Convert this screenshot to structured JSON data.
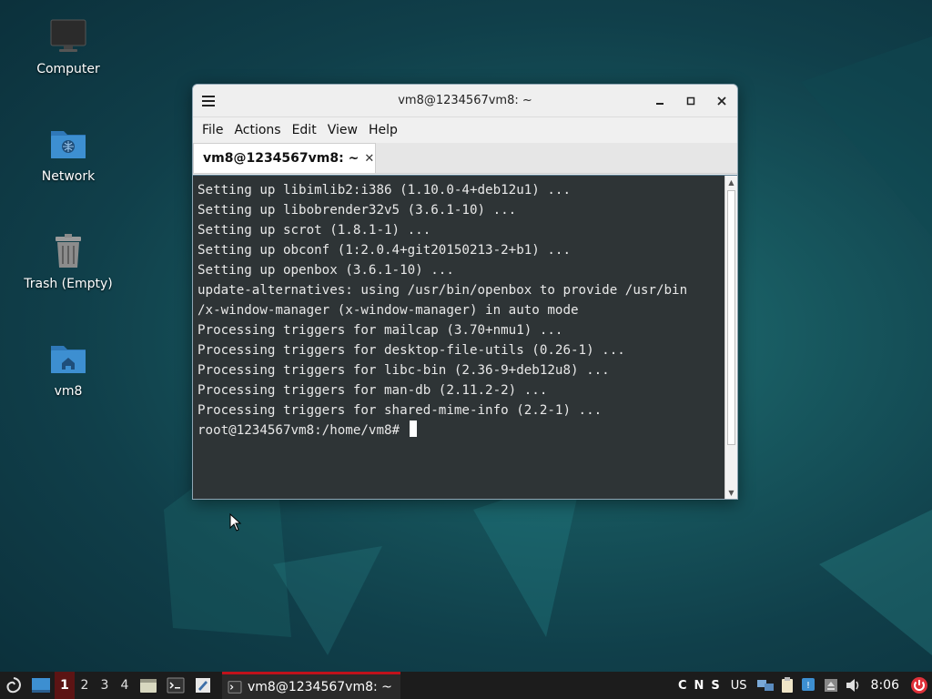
{
  "desktop": {
    "icons": [
      {
        "label": "Computer",
        "icon": "monitor-icon"
      },
      {
        "label": "Network",
        "icon": "network-folder-icon"
      },
      {
        "label": "Trash (Empty)",
        "icon": "trash-icon"
      },
      {
        "label": "vm8",
        "icon": "home-folder-icon"
      }
    ]
  },
  "window": {
    "title": "vm8@1234567vm8: ~",
    "menu": [
      "File",
      "Actions",
      "Edit",
      "View",
      "Help"
    ],
    "tab_label": "vm8@1234567vm8: ~",
    "tab_close": "✕",
    "terminal_lines": [
      "Setting up libimlib2:i386 (1.10.0-4+deb12u1) ...",
      "Setting up libobrender32v5 (3.6.1-10) ...",
      "Setting up scrot (1.8.1-1) ...",
      "Setting up obconf (1:2.0.4+git20150213-2+b1) ...",
      "Setting up openbox (3.6.1-10) ...",
      "update-alternatives: using /usr/bin/openbox to provide /usr/bin",
      "/x-window-manager (x-window-manager) in auto mode",
      "Processing triggers for mailcap (3.70+nmu1) ...",
      "Processing triggers for desktop-file-utils (0.26-1) ...",
      "Processing triggers for libc-bin (2.36-9+deb12u8) ...",
      "Processing triggers for man-db (2.11.2-2) ...",
      "Processing triggers for shared-mime-info (2.2-1) ..."
    ],
    "prompt": "root@1234567vm8:/home/vm8# "
  },
  "taskbar": {
    "workspaces": [
      "1",
      "2",
      "3",
      "4"
    ],
    "active_workspace": "1",
    "task_label": "vm8@1234567vm8: ~",
    "indicators": [
      "C",
      "N",
      "S"
    ],
    "keyboard_layout": "US",
    "clock": "8:06"
  },
  "colors": {
    "accent": "#c0121b",
    "terminal_bg": "#2e3436",
    "taskbar_bg": "#1c1c1c",
    "folder_blue": "#3d8fd1",
    "power_red": "#e0313a"
  }
}
